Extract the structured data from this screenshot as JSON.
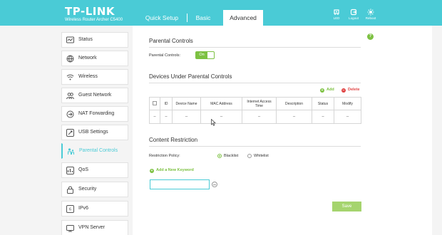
{
  "header": {
    "logo": "TP-LINK",
    "model": "Wireless Router Archer C5400",
    "tabs": [
      "Quick Setup",
      "Basic",
      "Advanced"
    ],
    "active_tab": "Advanced",
    "icons": [
      {
        "name": "led-icon",
        "label": "LED"
      },
      {
        "name": "logout-icon",
        "label": "Logout"
      },
      {
        "name": "reboot-icon",
        "label": "Reboot"
      }
    ]
  },
  "sidebar": {
    "items": [
      {
        "label": "Status",
        "icon": "status-icon"
      },
      {
        "label": "Network",
        "icon": "network-icon"
      },
      {
        "label": "Wireless",
        "icon": "wireless-icon"
      },
      {
        "label": "Guest Network",
        "icon": "guest-network-icon"
      },
      {
        "label": "NAT Forwarding",
        "icon": "nat-forwarding-icon"
      },
      {
        "label": "USB Settings",
        "icon": "usb-settings-icon"
      },
      {
        "label": "Parental Controls",
        "icon": "parental-controls-icon"
      },
      {
        "label": "QoS",
        "icon": "qos-icon"
      },
      {
        "label": "Security",
        "icon": "security-icon"
      },
      {
        "label": "IPv6",
        "icon": "ipv6-icon"
      },
      {
        "label": "VPN Server",
        "icon": "vpn-server-icon"
      }
    ],
    "active": "Parental Controls"
  },
  "help_label": "?",
  "parental_controls": {
    "title": "Parental Controls",
    "toggle_label": "Parental Controls:",
    "toggle_state": "On"
  },
  "devices": {
    "title": "Devices Under Parental Controls",
    "add_label": "Add",
    "delete_label": "Delete",
    "add_symbol": "+",
    "delete_symbol": "−",
    "columns": [
      "",
      "ID",
      "Device Name",
      "MAC Address",
      "Internet Access Time",
      "Description",
      "Status",
      "Modify"
    ],
    "row": [
      "--",
      "--",
      "--",
      "--",
      "--",
      "--",
      "--",
      "--"
    ]
  },
  "content_restriction": {
    "title": "Content Restriction",
    "policy_label": "Restriction Policy:",
    "options": [
      "Blacklist",
      "Whitelist"
    ],
    "selected": "Blacklist",
    "add_keyword_label": "Add a New Keyword",
    "keyword_value": ""
  },
  "save_label": "Save",
  "colors": {
    "accent": "#4acbd6",
    "green": "#7dc142",
    "red": "#e04545",
    "save": "#a5d46e"
  }
}
